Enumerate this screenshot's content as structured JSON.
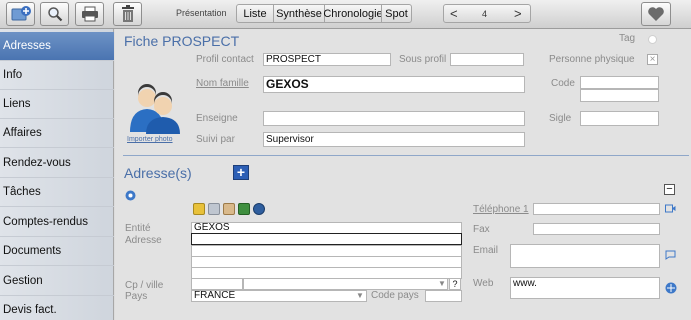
{
  "toolbar": {
    "icons": [
      "add-record-icon",
      "search-icon",
      "printer-icon",
      "trash-icon",
      "favorite-heart-icon"
    ],
    "presentation_label": "Présentation",
    "views": [
      "Liste",
      "Synthèse",
      "Chronologie",
      "Spot"
    ],
    "nav_prev": "<",
    "nav_next": ">",
    "record_number": "4"
  },
  "sidebar": {
    "items": [
      {
        "label": "Adresses",
        "active": true
      },
      {
        "label": "Info"
      },
      {
        "label": "Liens"
      },
      {
        "label": "Affaires"
      },
      {
        "label": "Rendez-vous"
      },
      {
        "label": "Tâches"
      },
      {
        "label": "Comptes-rendus"
      },
      {
        "label": "Documents"
      },
      {
        "label": "Gestion"
      },
      {
        "label": "Devis fact."
      }
    ]
  },
  "fiche": {
    "title": "Fiche PROSPECT",
    "tag_label": "Tag",
    "import_photo": "Importer photo",
    "profil_contact_label": "Profil contact",
    "profil_contact_value": "PROSPECT",
    "sous_profil_label": "Sous profil",
    "sous_profil_value": "",
    "personne_physique_label": "Personne physique",
    "personne_physique_checked": true,
    "nom_famille_label": "Nom famille",
    "nom_famille_value": "GEXOS",
    "code_label": "Code",
    "enseigne_label": "Enseigne",
    "sigle_label": "Sigle",
    "suivi_par_label": "Suivi par",
    "suivi_par_value": "Supervisor"
  },
  "adresses": {
    "title": "Adresse(s)",
    "add_button": "+",
    "collapse_button": "−",
    "entite_label": "Entité",
    "entite_value": "GEXOS",
    "adresse_label": "Adresse",
    "cp_ville_label": "Cp / ville",
    "pays_label": "Pays",
    "pays_value": "FRANCE",
    "code_pays_label": "Code pays",
    "help_button": "?",
    "telephone_label": "Téléphone 1",
    "fax_label": "Fax",
    "email_label": "Email",
    "web_label": "Web",
    "web_value": "www."
  },
  "colors": {
    "accent": "#4a6fa8",
    "sidebar_active": "#4a74b1",
    "add_button": "#2d5fb5"
  }
}
